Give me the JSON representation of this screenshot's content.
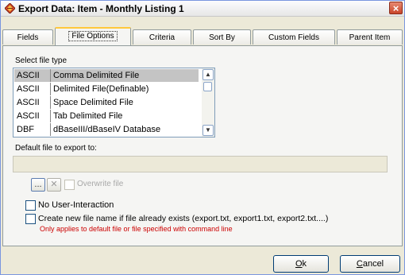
{
  "window": {
    "title": "Export Data:  Item - Monthly Listing 1",
    "close_symbol": "×"
  },
  "tabs": [
    {
      "label": "Fields",
      "active": false
    },
    {
      "label": "File Options",
      "active": true
    },
    {
      "label": "Criteria",
      "active": false
    },
    {
      "label": "Sort By",
      "active": false
    },
    {
      "label": "Custom Fields",
      "active": false
    },
    {
      "label": "Parent Item",
      "active": false
    }
  ],
  "file_type": {
    "label": "Select file type",
    "items": [
      {
        "type": "ASCII",
        "desc": "Comma Delimited File",
        "selected": true
      },
      {
        "type": "ASCII",
        "desc": "Delimited File(Definable)",
        "selected": false
      },
      {
        "type": "ASCII",
        "desc": "Space Delimited File",
        "selected": false
      },
      {
        "type": "ASCII",
        "desc": "Tab Delimited File",
        "selected": false
      },
      {
        "type": "DBF",
        "desc": "dBaseIII/dBaseIV Database",
        "selected": false
      }
    ]
  },
  "default_file": {
    "label": "Default file to export to:",
    "value": "",
    "browse_label": "...",
    "clear_label": "✕",
    "overwrite_label": "Overwrite file",
    "overwrite_checked": false
  },
  "options": {
    "no_interaction_label": "No User-Interaction",
    "no_interaction_checked": false,
    "create_new_label": "Create new file name if file already exists (export.txt, export1.txt, export2.txt....)",
    "create_new_checked": false,
    "note": "Only applies to default file or file specified with command line",
    "note_color": "#CC0000"
  },
  "buttons": {
    "ok_key": "O",
    "ok_rest": "k",
    "cancel_key": "C",
    "cancel_rest": "ancel"
  }
}
